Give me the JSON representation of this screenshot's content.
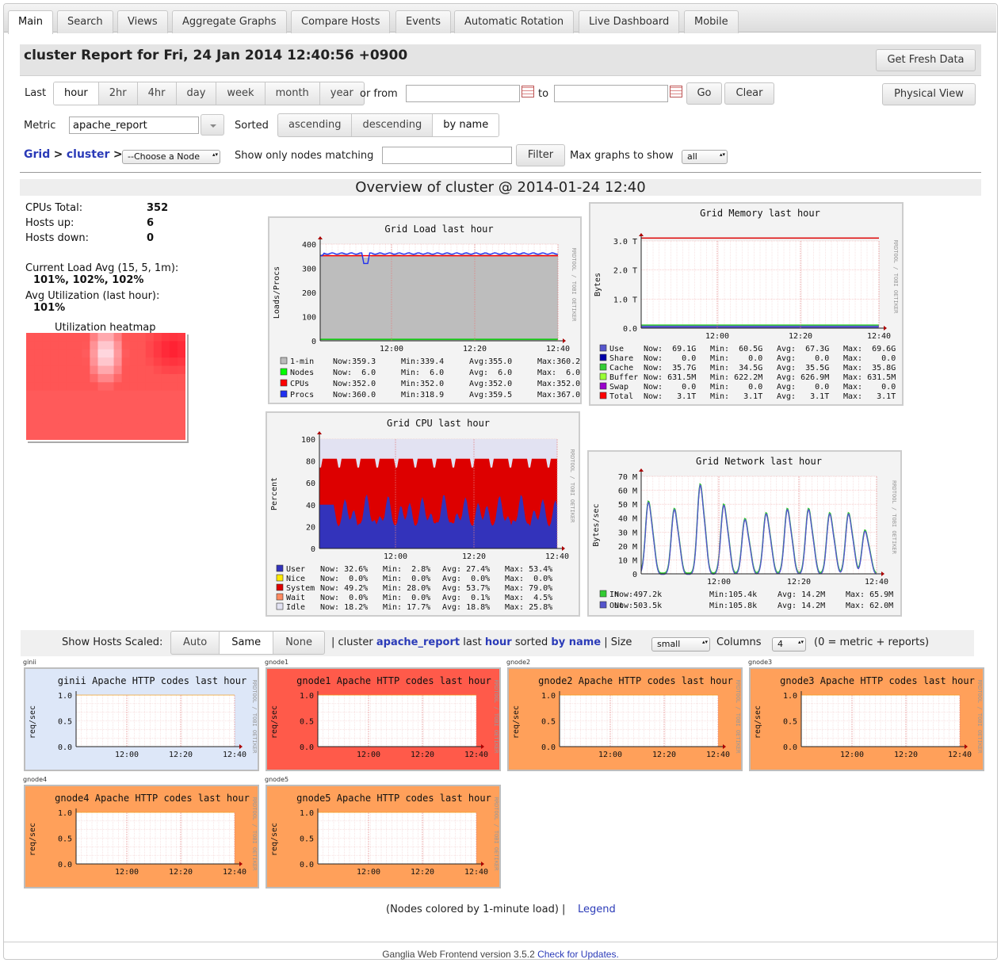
{
  "tabs": [
    "Main",
    "Search",
    "Views",
    "Aggregate Graphs",
    "Compare Hosts",
    "Events",
    "Automatic Rotation",
    "Live Dashboard",
    "Mobile"
  ],
  "title": "cluster Report for Fri, 24 Jan 2014 12:40:56 +0900",
  "get_fresh_data": "Get Fresh Data",
  "physical_view": "Physical View",
  "range": {
    "last_label": "Last",
    "options": [
      "hour",
      "2hr",
      "4hr",
      "day",
      "week",
      "month",
      "year"
    ],
    "selected": "hour",
    "or_from": "or from",
    "to": "to",
    "from_value": "",
    "to_value": "",
    "go": "Go",
    "clear": "Clear"
  },
  "metric": {
    "label": "Metric",
    "value": "apache_report",
    "sorted_label": "Sorted",
    "sort_options": [
      "ascending",
      "descending",
      "by name"
    ],
    "sort_selected": "by name"
  },
  "nav": {
    "grid": "Grid",
    "sep": ">",
    "cluster": "cluster",
    "choose_node": "--Choose a Node",
    "show_only": "Show only nodes matching",
    "filter_value": "",
    "filter": "Filter",
    "max_graphs": "Max graphs to show",
    "max_graphs_value": "all"
  },
  "overview_title": "Overview of cluster @ 2014-01-24 12:40",
  "stats": {
    "cpus_total_label": "CPUs Total:",
    "cpus_total": "352",
    "hosts_up_label": "Hosts up:",
    "hosts_up": "6",
    "hosts_down_label": "Hosts down:",
    "hosts_down": "0",
    "load_label": "Current Load Avg (15, 5, 1m):",
    "load_value": "101%, 102%, 102%",
    "util_label": "Avg Utilization (last hour):",
    "util_value": "101%",
    "heatmap_label": "Utilization heatmap"
  },
  "graphs": {
    "load": {
      "title": "Grid Load last hour",
      "ylabel": "Loads/Procs",
      "yticks": [
        "400",
        "300",
        "200",
        "100",
        "0"
      ],
      "xticks": [
        "12:00",
        "12:20",
        "12:40"
      ],
      "legend": [
        {
          "name": "1-min",
          "now": "Now:359.3",
          "min": "Min:339.4",
          "avg": "Avg:355.0",
          "max": "Max:360.2",
          "color": "#bbbbbb"
        },
        {
          "name": "Nodes",
          "now": "Now:  6.0",
          "min": "Min:  6.0",
          "avg": "Avg:  6.0",
          "max": "Max:  6.0",
          "color": "#00ff00"
        },
        {
          "name": "CPUs",
          "now": "Now:352.0",
          "min": "Min:352.0",
          "avg": "Avg:352.0",
          "max": "Max:352.0",
          "color": "#ff0000"
        },
        {
          "name": "Procs",
          "now": "Now:360.0",
          "min": "Min:318.9",
          "avg": "Avg:359.5",
          "max": "Max:367.0",
          "color": "#2030f0"
        }
      ]
    },
    "memory": {
      "title": "Grid Memory last hour",
      "ylabel": "Bytes",
      "yticks": [
        "3.0 T",
        "2.0 T",
        "1.0 T",
        "0.0"
      ],
      "xticks": [
        "12:00",
        "12:20",
        "12:40"
      ],
      "legend": [
        {
          "name": "Use",
          "now": "Now:  69.1G",
          "min": "Min:  60.5G",
          "avg": "Avg:  67.3G",
          "max": "Max:  69.6G",
          "color": "#5555cc"
        },
        {
          "name": "Share",
          "now": "Now:    0.0",
          "min": "Min:    0.0",
          "avg": "Avg:    0.0",
          "max": "Max:    0.0",
          "color": "#0000aa"
        },
        {
          "name": "Cache",
          "now": "Now:  35.7G",
          "min": "Min:  34.5G",
          "avg": "Avg:  35.5G",
          "max": "Max:  35.8G",
          "color": "#33cc33"
        },
        {
          "name": "Buffer",
          "now": "Now: 631.5M",
          "min": "Min: 622.2M",
          "avg": "Avg: 626.9M",
          "max": "Max: 631.5M",
          "color": "#99ff33"
        },
        {
          "name": "Swap",
          "now": "Now:    0.0",
          "min": "Min:    0.0",
          "avg": "Avg:    0.0",
          "max": "Max:    0.0",
          "color": "#9900cc"
        },
        {
          "name": "Total",
          "now": "Now:   3.1T",
          "min": "Min:   3.1T",
          "avg": "Avg:   3.1T",
          "max": "Max:   3.1T",
          "color": "#ff0000"
        }
      ]
    },
    "cpu": {
      "title": "Grid CPU last hour",
      "ylabel": "Percent",
      "yticks": [
        "100",
        "80",
        "60",
        "40",
        "20",
        "0"
      ],
      "xticks": [
        "12:00",
        "12:20",
        "12:40"
      ],
      "legend": [
        {
          "name": "User",
          "now": "Now: 32.6%",
          "min": "Min:  2.8%",
          "avg": "Avg: 27.4%",
          "max": "Max: 53.4%",
          "color": "#3333bb"
        },
        {
          "name": "Nice",
          "now": "Now:  0.0%",
          "min": "Min:  0.0%",
          "avg": "Avg:  0.0%",
          "max": "Max:  0.0%",
          "color": "#ffea00"
        },
        {
          "name": "System",
          "now": "Now: 49.2%",
          "min": "Min: 28.0%",
          "avg": "Avg: 53.7%",
          "max": "Max: 79.0%",
          "color": "#dd0000"
        },
        {
          "name": "Wait",
          "now": "Now:  0.0%",
          "min": "Min:  0.0%",
          "avg": "Avg:  0.1%",
          "max": "Max:  4.5%",
          "color": "#ff8a60"
        },
        {
          "name": "Idle",
          "now": "Now: 18.2%",
          "min": "Min: 17.7%",
          "avg": "Avg: 18.8%",
          "max": "Max: 25.8%",
          "color": "#e2e2f2"
        }
      ]
    },
    "network": {
      "title": "Grid Network last hour",
      "ylabel": "Bytes/sec",
      "yticks": [
        "70 M",
        "60 M",
        "50 M",
        "40 M",
        "30 M",
        "20 M",
        "10 M",
        "0"
      ],
      "xticks": [
        "12:00",
        "12:20",
        "12:40"
      ],
      "legend": [
        {
          "name": "In",
          "now": "Now:497.2k",
          "min": "Min:105.4k",
          "avg": "Avg: 14.2M",
          "max": "Max: 65.9M",
          "color": "#33cc33"
        },
        {
          "name": "Out",
          "now": "Now:503.5k",
          "min": "Min:105.8k",
          "avg": "Avg: 14.2M",
          "max": "Max: 62.0M",
          "color": "#5555cc"
        }
      ]
    }
  },
  "watermark": "RRDTOOL / TOBI OETIKER",
  "hosts_bar": {
    "show_scaled": "Show Hosts Scaled:",
    "scale_options": [
      "Auto",
      "Same",
      "None"
    ],
    "scale_selected": "Same",
    "sep1": "| cluster",
    "metric": "apache_report",
    "last": "last",
    "range": "hour",
    "sorted": "sorted",
    "by": "by name",
    "size_label": "| Size",
    "size_value": "small",
    "columns_label": "Columns",
    "columns_value": "4",
    "note": "(0 = metric + reports)"
  },
  "host_graphs": [
    {
      "host": "ginii",
      "title": "ginii Apache HTTP codes last hour",
      "bg": "#dde7f8"
    },
    {
      "host": "gnode1",
      "title": "gnode1 Apache HTTP codes last hour",
      "bg": "#ff5a4a"
    },
    {
      "host": "gnode2",
      "title": "gnode2 Apache HTTP codes last hour",
      "bg": "#ffa05a"
    },
    {
      "host": "gnode3",
      "title": "gnode3 Apache HTTP codes last hour",
      "bg": "#ffa05a"
    },
    {
      "host": "gnode4",
      "title": "gnode4 Apache HTTP codes last hour",
      "bg": "#ffa05a"
    },
    {
      "host": "gnode5",
      "title": "gnode5 Apache HTTP codes last hour",
      "bg": "#ffa05a"
    }
  ],
  "host_graph_axis": {
    "ylabel": "req/sec",
    "yticks": [
      "1.0",
      "0.5",
      "0.0"
    ],
    "xticks": [
      "12:00",
      "12:20",
      "12:40"
    ]
  },
  "nodes_colored": "(Nodes colored by 1-minute load) |",
  "legend_link": "Legend",
  "footer_text": "Ganglia Web Frontend version 3.5.2",
  "footer_link": "Check for Updates."
}
